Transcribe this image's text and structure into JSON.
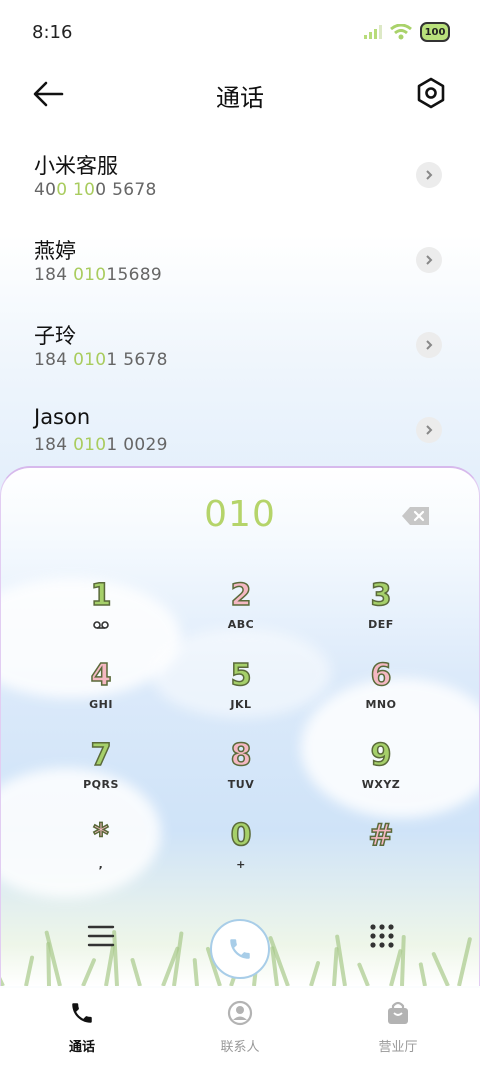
{
  "status": {
    "time": "8:16",
    "battery": "100",
    "icons": [
      "signal-icon",
      "wifi-icon",
      "battery-icon"
    ]
  },
  "header": {
    "title": "通话",
    "back_icon": "back-arrow-icon",
    "settings_icon": "settings-icon"
  },
  "contacts": [
    {
      "name": "小米客服",
      "number_parts": [
        "40",
        "0 10",
        "0 5678"
      ]
    },
    {
      "name": "燕婷",
      "number_parts": [
        "184 ",
        "010",
        "15689"
      ]
    },
    {
      "name": "子玲",
      "number_parts": [
        "184 ",
        "010",
        "1 5678"
      ]
    },
    {
      "name": "Jason",
      "number_parts": [
        "184 ",
        "010",
        "1 0029"
      ]
    }
  ],
  "dialpad": {
    "input": "010",
    "keys": [
      {
        "num": "1",
        "sub": "voicemail-icon",
        "color": "#a6d06a"
      },
      {
        "num": "2",
        "sub": "ABC",
        "color": "#f5b8c2"
      },
      {
        "num": "3",
        "sub": "DEF",
        "color": "#a6d06a"
      },
      {
        "num": "4",
        "sub": "GHI",
        "color": "#f5b8c2"
      },
      {
        "num": "5",
        "sub": "JKL",
        "color": "#a6d06a"
      },
      {
        "num": "6",
        "sub": "MNO",
        "color": "#f5b8c2"
      },
      {
        "num": "7",
        "sub": "PQRS",
        "color": "#a6d06a"
      },
      {
        "num": "8",
        "sub": "TUV",
        "color": "#f5b8c2"
      },
      {
        "num": "9",
        "sub": "WXYZ",
        "color": "#a6d06a"
      },
      {
        "num": "*",
        "sub": ",",
        "color": "#f5b8c2"
      },
      {
        "num": "0",
        "sub": "+",
        "color": "#a6d06a"
      },
      {
        "num": "#",
        "sub": "",
        "color": "#f5b8c2"
      }
    ]
  },
  "tabs": [
    {
      "label": "通话",
      "icon": "phone-icon",
      "active": true
    },
    {
      "label": "联系人",
      "icon": "contacts-icon",
      "active": false
    },
    {
      "label": "营业厅",
      "icon": "shopping-bag-icon",
      "active": false
    }
  ],
  "colors": {
    "accent_green": "#b5d46a",
    "accent_pink": "#f5b8c2",
    "call_blue": "#a8cde8"
  }
}
